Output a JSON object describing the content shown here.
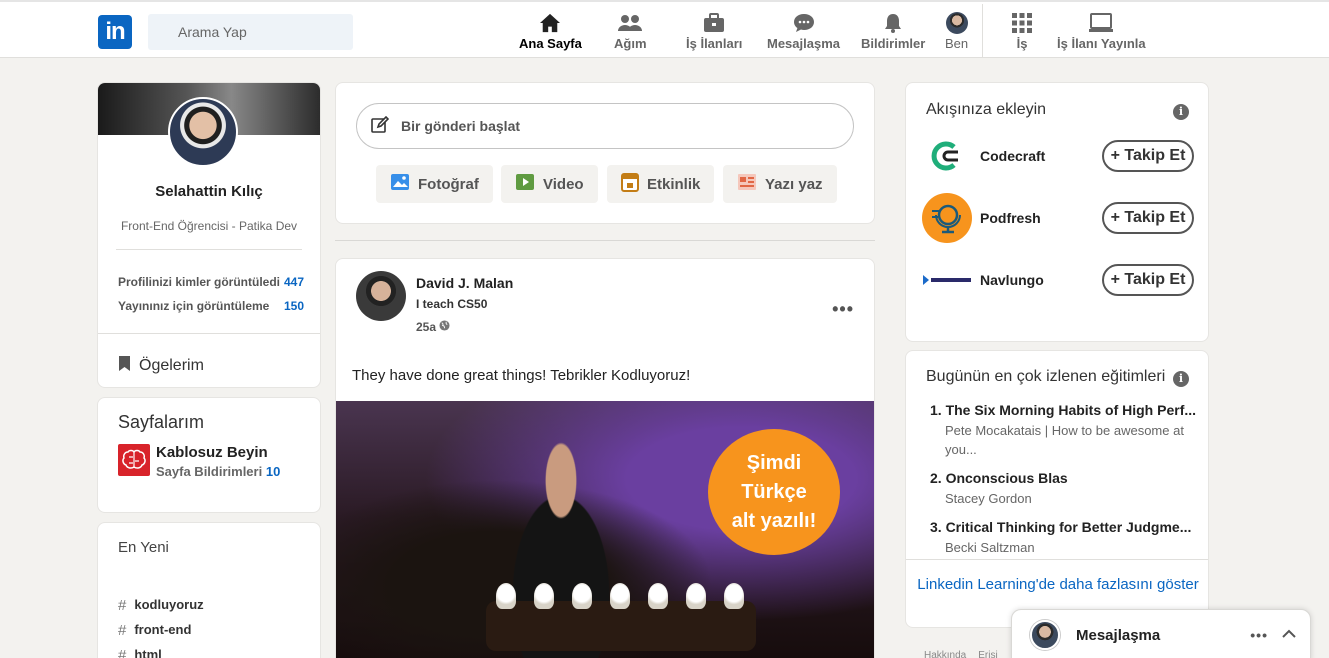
{
  "nav": {
    "search_placeholder": "Arama Yap",
    "items": [
      {
        "label": "Ana Sayfa",
        "icon": "home-icon"
      },
      {
        "label": "Ağım",
        "icon": "network-icon"
      },
      {
        "label": "İş İlanları",
        "icon": "jobs-icon"
      },
      {
        "label": "Mesajlaşma",
        "icon": "messaging-icon"
      },
      {
        "label": "Bildirimler",
        "icon": "bell-icon"
      },
      {
        "label": "Ben",
        "icon": "avatar"
      },
      {
        "label": "İş",
        "icon": "grid-icon"
      },
      {
        "label": "İş İlanı Yayınla",
        "icon": "post-job-icon"
      }
    ],
    "logo_text": "in"
  },
  "profile": {
    "name": "Selahattin Kılıç",
    "headline": "Front-End Öğrencisi - Patika Dev",
    "stats": [
      {
        "label": "Profilinizi kimler görüntüledi",
        "value": "447"
      },
      {
        "label": "Yayınınız için görüntüleme",
        "value": "150"
      }
    ],
    "items_label": "Ögelerim"
  },
  "pages": {
    "title": "Sayfalarım",
    "page_name": "Kablosuz Beyin",
    "notif_label": "Sayfa Bildirimleri",
    "notif_count": "10"
  },
  "recent": {
    "title": "En Yeni",
    "tags": [
      "kodluyoruz",
      "front-end",
      "html"
    ]
  },
  "composer": {
    "placeholder": "Bir gönderi başlat",
    "actions": [
      {
        "label": "Fotoğraf",
        "icon": "photo-icon",
        "color": "#378fe9"
      },
      {
        "label": "Video",
        "icon": "video-icon",
        "color": "#5f9b41"
      },
      {
        "label": "Etkinlik",
        "icon": "event-icon",
        "color": "#c37d16"
      },
      {
        "label": "Yazı yaz",
        "icon": "article-icon",
        "color": "#e16745"
      }
    ]
  },
  "post": {
    "author": "David J. Malan",
    "subtitle": "I teach CS50",
    "time": "25a",
    "text": "They have done great things! Tebrikler Kodluyoruz!",
    "badge_lines": [
      "Şimdi",
      "Türkçe",
      "alt yazılı!"
    ]
  },
  "feed_suggestions": {
    "title": "Akışınıza ekleyin",
    "follow_label": "+ Takip Et",
    "items": [
      {
        "name": "Codecraft"
      },
      {
        "name": "Podfresh"
      },
      {
        "name": "Navlungo"
      }
    ]
  },
  "courses": {
    "title": "Bugünün en çok izlenen eğitimleri",
    "items": [
      {
        "title": "1. The Six Morning Habits of High Perf...",
        "author": "Pete Mocakatais | How to be awesome at you..."
      },
      {
        "title": "2. Onconscious Blas",
        "author": "Stacey Gordon"
      },
      {
        "title": "3. Critical Thinking for Better Judgme...",
        "author": "Becki Saltzman"
      }
    ],
    "more_link": "Linkedin Learning'de daha fazlasını göster"
  },
  "messaging": {
    "label": "Mesajlaşma"
  },
  "footer": {
    "links": [
      "Hakkında",
      "Erişi"
    ]
  },
  "colors": {
    "brand": "#0a66c2",
    "badge": "#f7941d"
  }
}
